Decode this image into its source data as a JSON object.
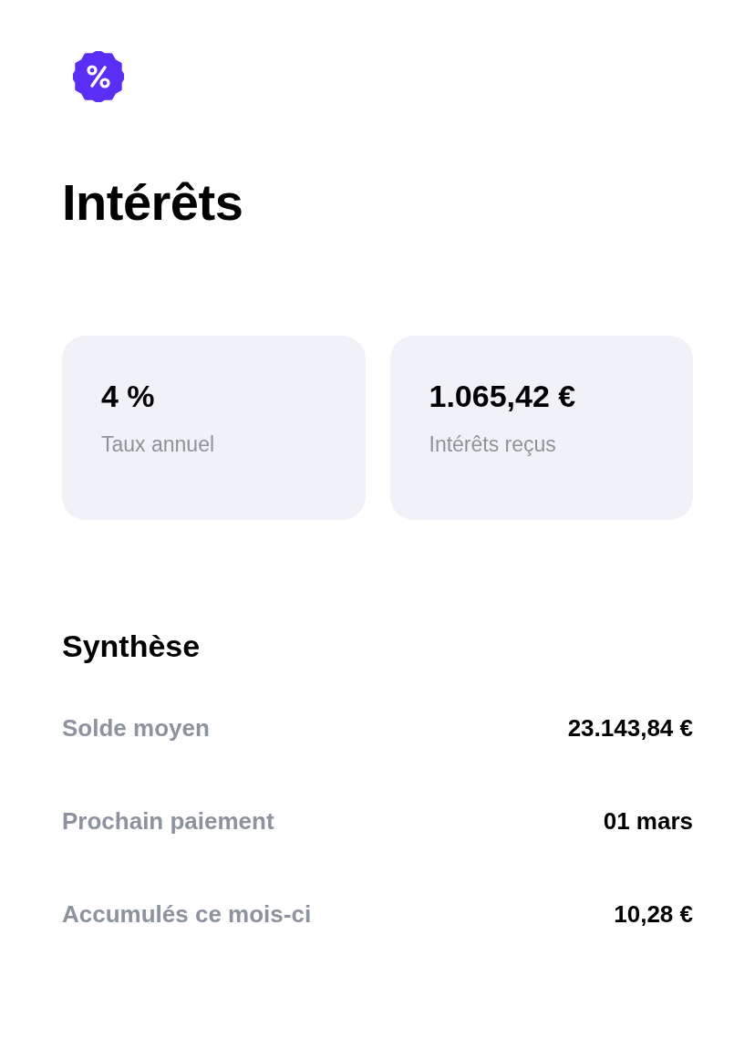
{
  "title": "Intérêts",
  "cards": [
    {
      "value": "4 %",
      "label": "Taux annuel"
    },
    {
      "value": "1.065,42 €",
      "label": "Intérêts reçus"
    }
  ],
  "summary": {
    "heading": "Synthèse",
    "rows": [
      {
        "label": "Solde moyen",
        "value": "23.143,84 €"
      },
      {
        "label": "Prochain paiement",
        "value": "01 mars"
      },
      {
        "label": "Accumulés ce mois-ci",
        "value": "10,28 €"
      }
    ]
  }
}
